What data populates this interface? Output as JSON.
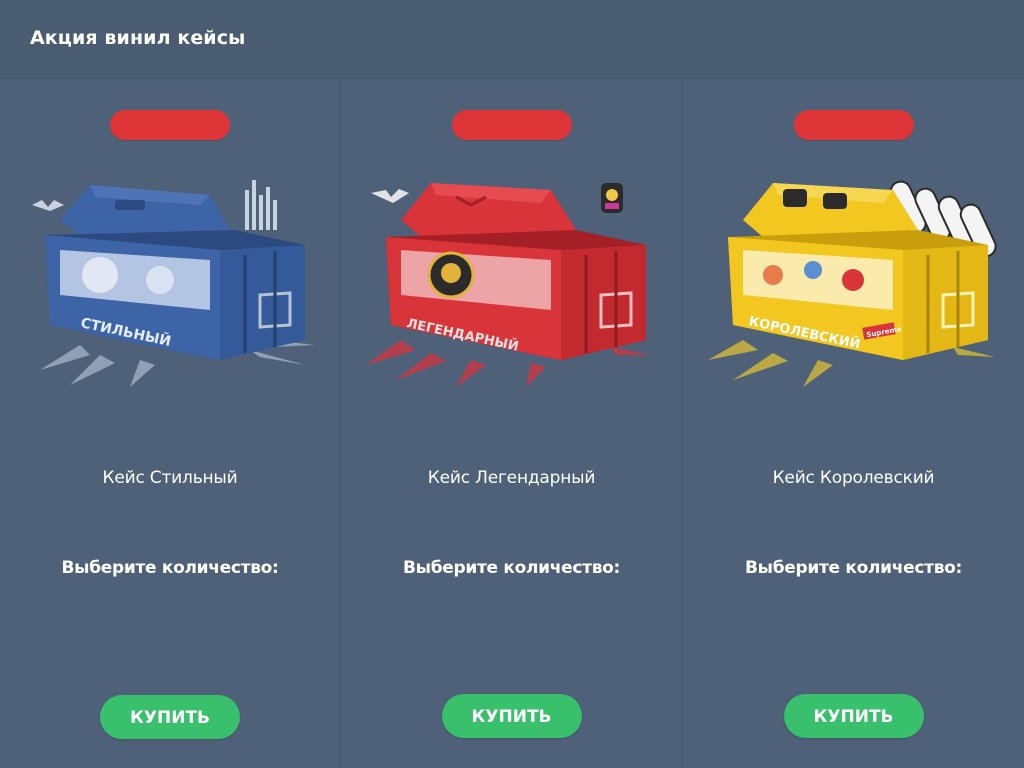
{
  "header": {
    "title": "Акция винил кейсы"
  },
  "cases": [
    {
      "name": "Кейс Стильный",
      "case_label": "СТИЛЬНЫЙ",
      "case_color": "#3e64a8",
      "case_dark": "#2c4a80",
      "splash_color": "#c7d4ea",
      "qty_label": "Выберите количество:",
      "buy_label": "КУПИТЬ"
    },
    {
      "name": "Кейс Легендарный",
      "case_label": "ЛЕГЕНДАРНЫЙ",
      "case_color": "#d9343a",
      "case_dark": "#a51f26",
      "splash_color": "#e0313a",
      "qty_label": "Выберите количество:",
      "buy_label": "КУПИТЬ"
    },
    {
      "name": "Кейс Королевский",
      "case_label": "КОРОЛЕВСКИЙ",
      "case_color": "#f2c71f",
      "case_dark": "#c89e0c",
      "splash_color": "#f2cf2a",
      "qty_label": "Выберите количество:",
      "buy_label": "КУПИТЬ",
      "sticker_text": "Supreme"
    }
  ],
  "colors": {
    "price_badge": "#de3538",
    "buy_button": "#39c06c",
    "background": "#4f6178"
  }
}
